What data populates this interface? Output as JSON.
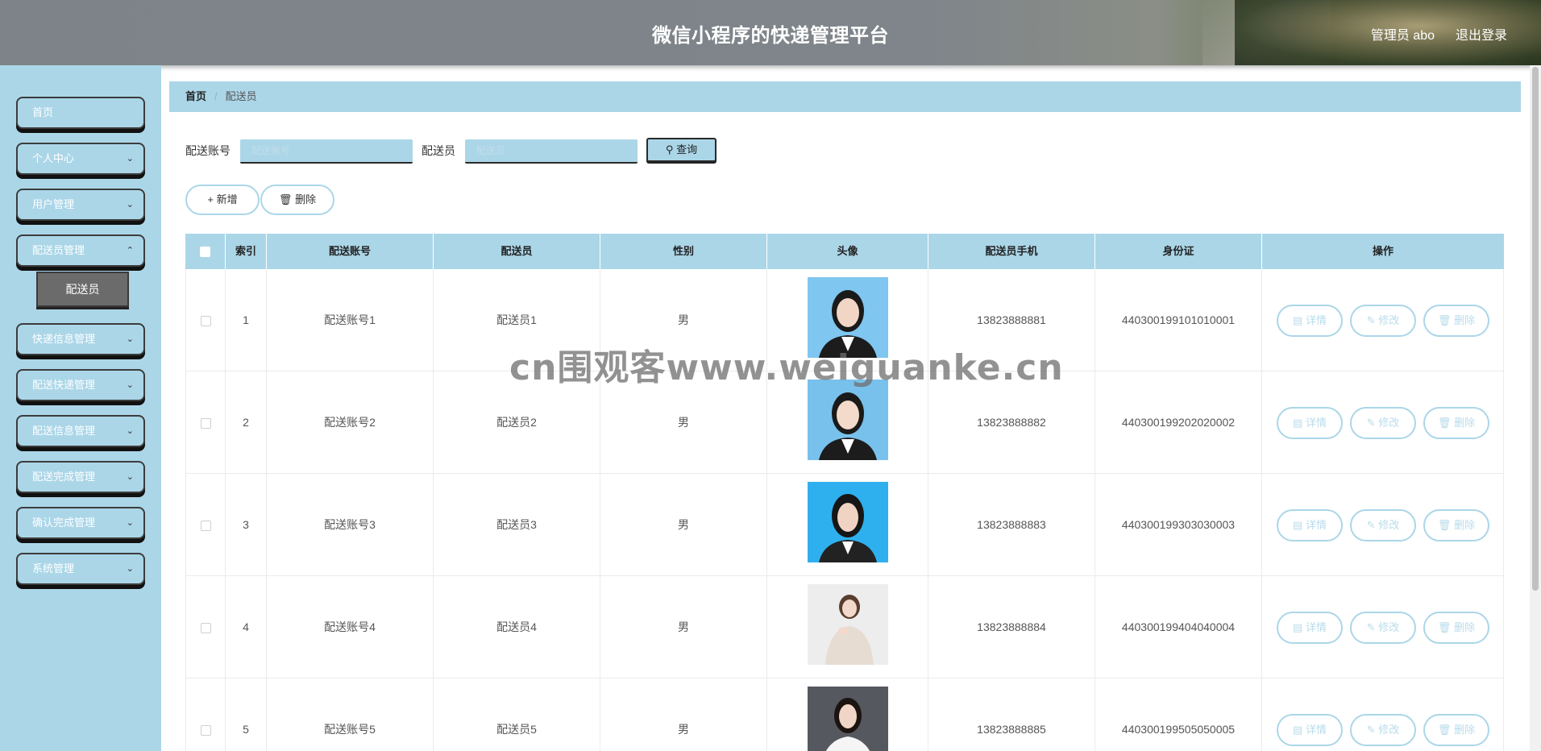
{
  "header": {
    "title": "微信小程序的快递管理平台",
    "user_label": "管理员 abo",
    "logout_label": "退出登录"
  },
  "sidebar": {
    "items": [
      {
        "label": "首页",
        "has_children": false
      },
      {
        "label": "个人中心",
        "has_children": true
      },
      {
        "label": "用户管理",
        "has_children": true
      },
      {
        "label": "配送员管理",
        "has_children": true
      },
      {
        "label": "快递信息管理",
        "has_children": true
      },
      {
        "label": "配送快递管理",
        "has_children": true
      },
      {
        "label": "配送信息管理",
        "has_children": true
      },
      {
        "label": "配送完成管理",
        "has_children": true
      },
      {
        "label": "确认完成管理",
        "has_children": true
      },
      {
        "label": "系统管理",
        "has_children": true
      }
    ],
    "sub_item": "配送员"
  },
  "breadcrumb": {
    "home": "首页",
    "separator": "/",
    "current": "配送员"
  },
  "search": {
    "account_label": "配送账号",
    "account_placeholder": "配送账号",
    "name_label": "配送员",
    "name_placeholder": "配送员",
    "query_label": "查询"
  },
  "toolbar": {
    "add_label": "新增",
    "delete_label": "删除"
  },
  "table": {
    "columns": [
      "索引",
      "配送账号",
      "配送员",
      "性别",
      "头像",
      "配送员手机",
      "身份证",
      "操作"
    ],
    "rows": [
      {
        "index": "1",
        "account": "配送账号1",
        "name": "配送员1",
        "gender": "男",
        "phone": "13823888881",
        "id_card": "440300199101010001"
      },
      {
        "index": "2",
        "account": "配送账号2",
        "name": "配送员2",
        "gender": "男",
        "phone": "13823888882",
        "id_card": "440300199202020002"
      },
      {
        "index": "3",
        "account": "配送账号3",
        "name": "配送员3",
        "gender": "男",
        "phone": "13823888883",
        "id_card": "440300199303030003"
      },
      {
        "index": "4",
        "account": "配送账号4",
        "name": "配送员4",
        "gender": "男",
        "phone": "13823888884",
        "id_card": "440300199404040004"
      },
      {
        "index": "5",
        "account": "配送账号5",
        "name": "配送员5",
        "gender": "男",
        "phone": "13823888885",
        "id_card": "440300199505050005"
      }
    ],
    "actions": {
      "detail": "详情",
      "edit": "修改",
      "delete": "删除"
    }
  },
  "watermark": "cn围观客www.weiguanke.cn",
  "colors": {
    "accent": "#abd6e8",
    "header_bg": "#7f858a",
    "sub_item_bg": "#6b6b6b"
  }
}
